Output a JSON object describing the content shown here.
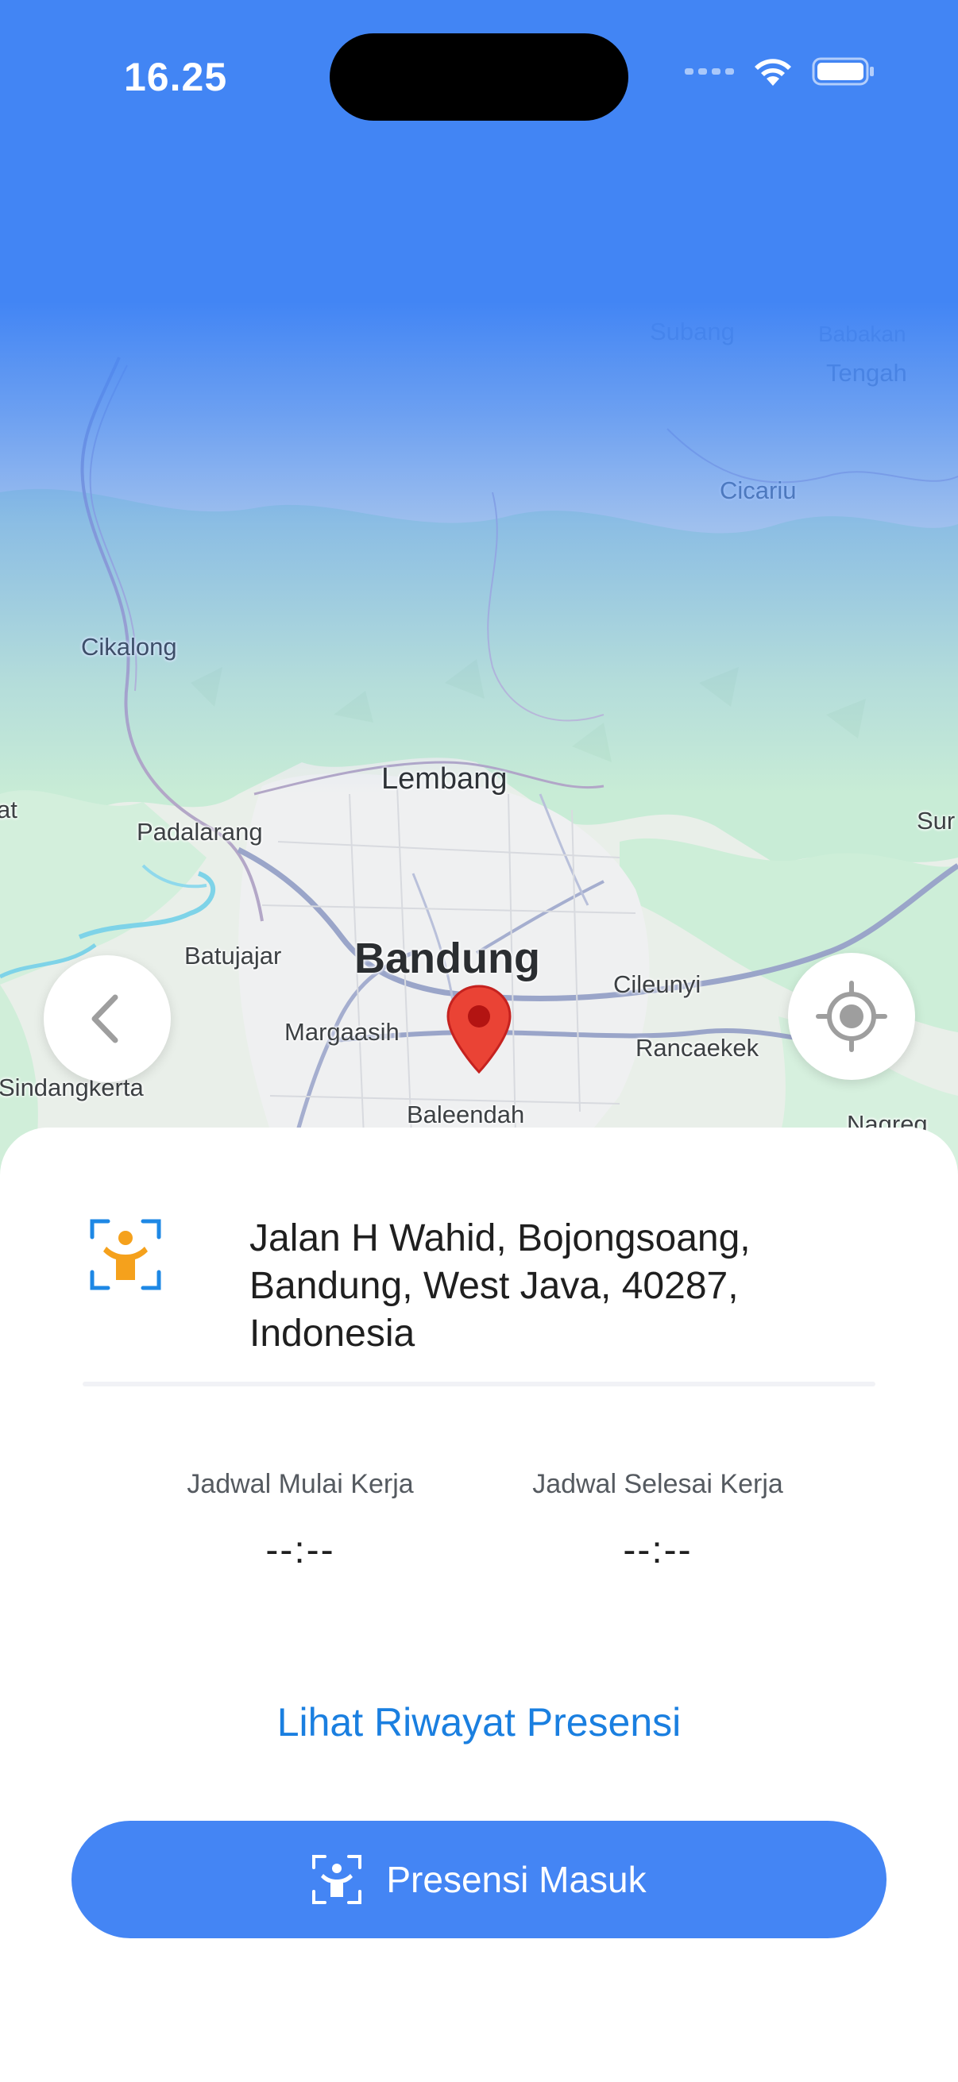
{
  "status_bar": {
    "time": "16.25",
    "icons": [
      "cellular-icon",
      "wifi-icon",
      "battery-icon"
    ]
  },
  "map": {
    "labels": {
      "subang": "Subang",
      "babakan_tengah_1": "Babakan",
      "babakan_tengah_2": "Tengah",
      "cicariu": "Cicariu",
      "cikalong": "Cikalong",
      "lembang": "Lembang",
      "cikalong_wetan": "at",
      "padalarang": "Padalarang",
      "sumedang": "Sur",
      "batujajar": "Batujajar",
      "bandung": "Bandung",
      "cileunyi": "Cileunyi",
      "margaasih": "Margaasih",
      "rancaekek": "Rancaekek",
      "sindangkerta": "Sindangkerta",
      "baleendah": "Baleendah",
      "nagreg": "Nagreg"
    },
    "marker_color": "#ea4335"
  },
  "sheet": {
    "address": "Jalan H Wahid, Bojongsoang, Bandung, West Java, 40287, Indonesia",
    "schedule_start_label": "Jadwal Mulai Kerja",
    "schedule_start_value": "--:--",
    "schedule_end_label": "Jadwal Selesai Kerja",
    "schedule_end_value": "--:--",
    "history_link": "Lihat Riwayat Presensi",
    "checkin_button": "Presensi Masuk"
  },
  "colors": {
    "primary": "#4485f4",
    "link": "#1a7fe0",
    "accent_orange": "#f5a11c",
    "icon_frame": "#1e88e5"
  }
}
